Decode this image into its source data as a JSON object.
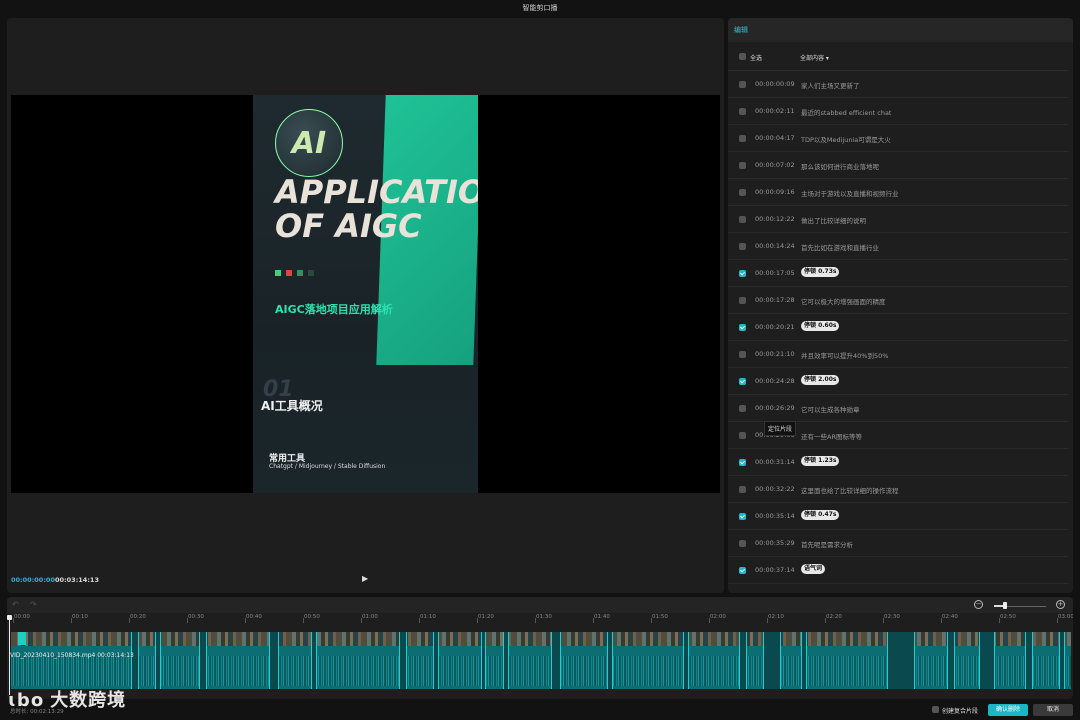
{
  "window": {
    "title": "智能剪口播"
  },
  "player": {
    "current_time": "00:00:00:00",
    "total_time": "00:03:14:13",
    "poster": {
      "logo_text": "AI",
      "headline_1": "APPLICATIO",
      "headline_2": "OF AIGC",
      "subtitle": "AIGC落地项目应用解析",
      "section_num": "01",
      "section_title": "AI工具概况",
      "common_tools": "常用工具",
      "tools_list": "Chatgpt / Midjourney / Stable Diffusion"
    }
  },
  "panel": {
    "title": "编辑",
    "select_all": "全选",
    "filter": "全部内容 ▾",
    "rows": [
      {
        "time": "00:00:00:09",
        "text": "家人们主场又更新了",
        "checked": false,
        "pill": false
      },
      {
        "time": "00:00:02:11",
        "text": "最近的stabbed efficient chat",
        "checked": false,
        "pill": false
      },
      {
        "time": "00:00:04:17",
        "text": "TDP以及Medijunia可谓是大火",
        "checked": false,
        "pill": false
      },
      {
        "time": "00:00:07:02",
        "text": "那么该如何进行商业落地呢",
        "checked": false,
        "pill": false
      },
      {
        "time": "00:00:09:16",
        "text": "主场对于游戏以及直播和视频行业",
        "checked": false,
        "pill": false
      },
      {
        "time": "00:00:12:22",
        "text": "做出了比较详细的说明",
        "checked": false,
        "pill": false
      },
      {
        "time": "00:00:14:24",
        "text": "首先比如在游戏和直播行业",
        "checked": false,
        "pill": false
      },
      {
        "time": "00:00:17:05",
        "text": "停顿 0.73s",
        "checked": true,
        "pill": true
      },
      {
        "time": "00:00:17:28",
        "text": "它可以极大的增强画面的精度",
        "checked": false,
        "pill": false
      },
      {
        "time": "00:00:20:21",
        "text": "停顿 0.60s",
        "checked": true,
        "pill": true
      },
      {
        "time": "00:00:21:10",
        "text": "并且效率可以提升40%到50%",
        "checked": false,
        "pill": false
      },
      {
        "time": "00:00:24:28",
        "text": "停顿 2.00s",
        "checked": true,
        "pill": true
      },
      {
        "time": "00:00:26:29",
        "text": "它可以生成各种勋章",
        "checked": false,
        "pill": false
      },
      {
        "time": "00:00:29:06",
        "text": "还有一些AR图标等等",
        "checked": false,
        "pill": false
      },
      {
        "time": "00:00:31:14",
        "text": "停顿 1.23s",
        "checked": true,
        "pill": true
      },
      {
        "time": "00:00:32:22",
        "text": "这里面也给了比较详细的操作流程",
        "checked": false,
        "pill": false
      },
      {
        "time": "00:00:35:14",
        "text": "停顿 0.47s",
        "checked": true,
        "pill": true
      },
      {
        "time": "00:00:35:29",
        "text": "首先呢是需求分析",
        "checked": false,
        "pill": false
      },
      {
        "time": "00:00:37:14",
        "text": "语气词",
        "checked": true,
        "pill": true
      }
    ],
    "tooltip": "定位片段"
  },
  "timeline": {
    "ticks": [
      "00:00",
      "00:10",
      "00:20",
      "00:30",
      "00:40",
      "00:50",
      "01:00",
      "01:10",
      "01:20",
      "01:30",
      "01:40",
      "01:50",
      "02:00",
      "02:10",
      "02:20",
      "02:30",
      "02:40",
      "02:50",
      "03:00"
    ],
    "clip_label": "VID_20230410_150834.mp4  00:03:14:13",
    "zoom_level": 0.2
  },
  "footer": {
    "watermark": "大数跨境",
    "watermark_logo": "ɩbo",
    "total_duration": "总时长:  00:02:13:29",
    "compound_label": "创建复合片段",
    "confirm": "确认删除",
    "cancel": "取消"
  },
  "colors": {
    "accent": "#1ab6c6",
    "panel": "#1e1e1e",
    "background": "#121212"
  }
}
